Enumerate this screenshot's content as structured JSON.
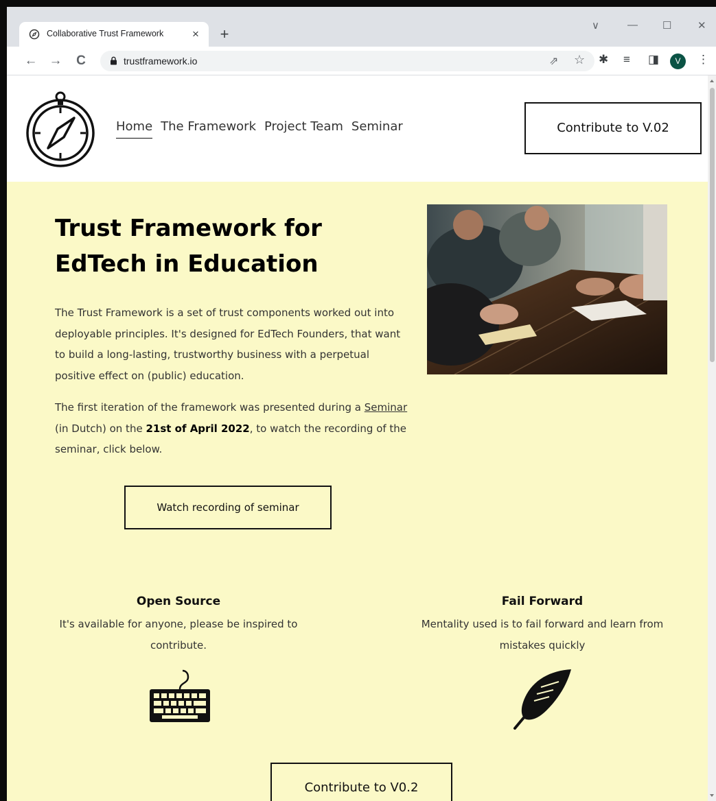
{
  "browser": {
    "tab_title": "Collaborative Trust Framework",
    "tab_close": "×",
    "new_tab": "+",
    "url": "trustframework.io",
    "profile_initial": "V",
    "window_controls": {
      "chevron": "∨",
      "minimize": "—",
      "maximize": "☐",
      "close": "✕"
    },
    "nav": {
      "back": "←",
      "forward": "→",
      "reload": "C"
    },
    "toolbar_icons": {
      "share": "⇗",
      "star": "☆",
      "extensions": "✱",
      "media": "≡",
      "sidepanel": "◨",
      "menu": "⋮"
    }
  },
  "header": {
    "nav_items": [
      {
        "label": "Home",
        "active": true
      },
      {
        "label": "The Framework",
        "active": false
      },
      {
        "label": "Project Team",
        "active": false
      },
      {
        "label": "Seminar",
        "active": false
      }
    ],
    "cta_label": "Contribute to V.02"
  },
  "hero": {
    "title": "Trust Framework for EdTech in Education",
    "paragraph1": "The Trust Framework is a set of trust components worked out into deployable principles. It's designed for EdTech Founders, that want to build a long-lasting, trustworthy business with a perpetual positive effect on (public) education.",
    "paragraph2": {
      "before_link": "The first iteration of the framework was presented during a ",
      "link": "Seminar",
      "middle": " (in Dutch) on the ",
      "bold": "21st of April 2022",
      "after": ", to watch the recording of the seminar, click below."
    },
    "watch_button": "Watch recording of seminar"
  },
  "features": [
    {
      "title": "Open Source",
      "description": "It's available for anyone, please be inspired to contribute.",
      "icon": "keyboard-icon"
    },
    {
      "title": "Fail Forward",
      "description": "Mentality used is to fail forward and learn from mistakes quickly",
      "icon": "feather-icon"
    }
  ],
  "bottom_cta": "Contribute to V0.2",
  "colors": {
    "hero_background": "#fbf9c7",
    "text": "#333333",
    "avatar": "#0b5345"
  }
}
